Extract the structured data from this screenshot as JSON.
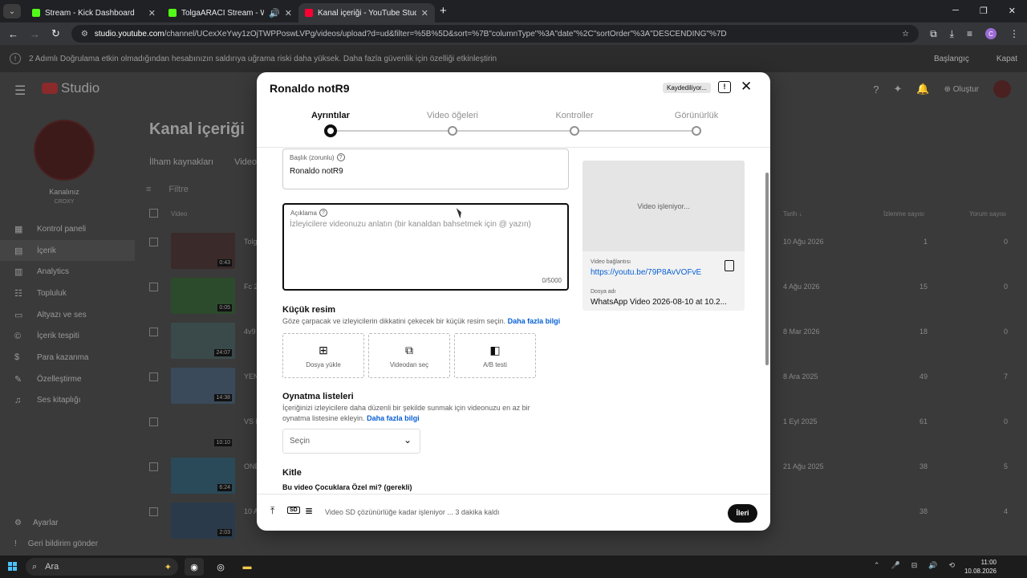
{
  "browser": {
    "tabs": [
      {
        "title": "Stream - Kick Dashboard",
        "color": "#53fc18",
        "active": false
      },
      {
        "title": "TolgaARACI Stream - Watch",
        "color": "#53fc18",
        "active": false
      },
      {
        "title": "Kanal içeriği - YouTube Studio",
        "color": "#ff0033",
        "active": true
      }
    ],
    "url_host": "studio.youtube.com",
    "url_path": "/channel/UCexXeYwy1zOjTWPPoswLVPg/videos/upload?d=ud&filter=%5B%5D&sort=%7B\"columnType\"%3A\"date\"%2C\"sortOrder\"%3A\"DESCENDING\"%7D",
    "profile_letter": "C"
  },
  "notice": {
    "text": "2 Adımlı Doğrulama etkin olmadığından hesabınızın saldırıya uğrama riski daha yüksek. Daha fazla güvenlik için özelliği etkinleştirin",
    "start": "Başlangıç",
    "close": "Kapat"
  },
  "studio": {
    "logo": "Studio",
    "create": "Oluştur",
    "channel_name": "Kanalınız",
    "channel_handle": "CROXY",
    "nav": [
      {
        "label": "Kontrol paneli",
        "icon": "▦"
      },
      {
        "label": "İçerik",
        "icon": "▤",
        "active": true
      },
      {
        "label": "Analytics",
        "icon": "▥"
      },
      {
        "label": "Topluluk",
        "icon": "☷"
      },
      {
        "label": "Altyazı ve ses",
        "icon": "▭"
      },
      {
        "label": "İçerik tespiti",
        "icon": "©"
      },
      {
        "label": "Para kazanma",
        "icon": "$"
      },
      {
        "label": "Özelleştirme",
        "icon": "✎"
      },
      {
        "label": "Ses kitaplığı",
        "icon": "♫"
      }
    ],
    "nav_bottom": [
      {
        "label": "Ayarlar",
        "icon": "⚙"
      },
      {
        "label": "Geri bildirim gönder",
        "icon": "!"
      }
    ],
    "page_title": "Kanal içeriği",
    "tabs": [
      "İlham kaynakları",
      "Video"
    ],
    "filter": "Filtre",
    "col_video": "Video",
    "col_date": "Tarih ↓",
    "col_views": "İzlenme sayısı",
    "col_comments": "Yorum sayısı",
    "rows": [
      {
        "name": "Tolg",
        "duration": "0:43",
        "date": "10 Ağu 2026",
        "views": "1",
        "comments": "0"
      },
      {
        "name": "Fc 2",
        "duration": "0:05",
        "date": "4 Ağu 2026",
        "views": "15",
        "comments": "0"
      },
      {
        "name": "4v9",
        "duration": "24:07",
        "date": "8 Mar 2026",
        "views": "18",
        "comments": "0"
      },
      {
        "name": "YEN",
        "duration": "14:38",
        "date": "8 Ara 2025",
        "views": "49",
        "comments": "7"
      },
      {
        "name": "VS I",
        "duration": "10:10",
        "date": "1 Eyl 2025",
        "views": "61",
        "comments": "0"
      },
      {
        "name": "ONE",
        "duration": "6:24",
        "date": "21 Ağu 2025",
        "views": "38",
        "comments": "5"
      },
      {
        "name": "10 A",
        "duration": "2:03",
        "date": "",
        "views": "38",
        "comments": "4"
      }
    ]
  },
  "modal": {
    "title": "Ronaldo notR9",
    "saving": "Kaydediliyor...",
    "steps": [
      "Ayrıntılar",
      "Video öğeleri",
      "Kontroller",
      "Görünürlük"
    ],
    "title_label": "Başlık (zorunlu)",
    "title_value": "Ronaldo notR9",
    "desc_label": "Açıklama",
    "desc_placeholder": "İzleyicilere videonuzu anlatın (bir kanaldan bahsetmek için @ yazın)",
    "desc_count": "0/5000",
    "thumb_title": "Küçük resim",
    "thumb_desc": "Göze çarpacak ve izleyicilerin dikkatini çekecek bir küçük resim seçin.",
    "learn_more": "Daha fazla bilgi",
    "thumb_buttons": [
      {
        "label": "Dosya yükle",
        "icon": "upload-image-icon"
      },
      {
        "label": "Videodan seç",
        "icon": "gallery-icon"
      },
      {
        "label": "A/B testi",
        "icon": "ab-test-icon"
      }
    ],
    "playlists_title": "Oynatma listeleri",
    "playlists_desc": "İçeriğinizi izleyicilere daha düzenli bir şekilde sunmak için videonuzu en az bir oynatma listesine ekleyin.",
    "playlists_select": "Seçin",
    "audience_title": "Kitle",
    "audience_question": "Bu video Çocuklara Özel mi? (gerekli)",
    "preview_status": "Video işleniyor...",
    "video_link_label": "Video bağlantısı",
    "video_link": "https://youtu.be/79P8AvVOFvE",
    "filename_label": "Dosya adı",
    "filename": "WhatsApp Video 2026-08-10 at 10.2...",
    "footer_status": "Video SD çözünürlüğe kadar işleniyor ... 3 dakika kaldı",
    "next_button": "İleri"
  },
  "taskbar": {
    "search": "Ara",
    "time": "11:00",
    "date": "10.08.2026"
  }
}
